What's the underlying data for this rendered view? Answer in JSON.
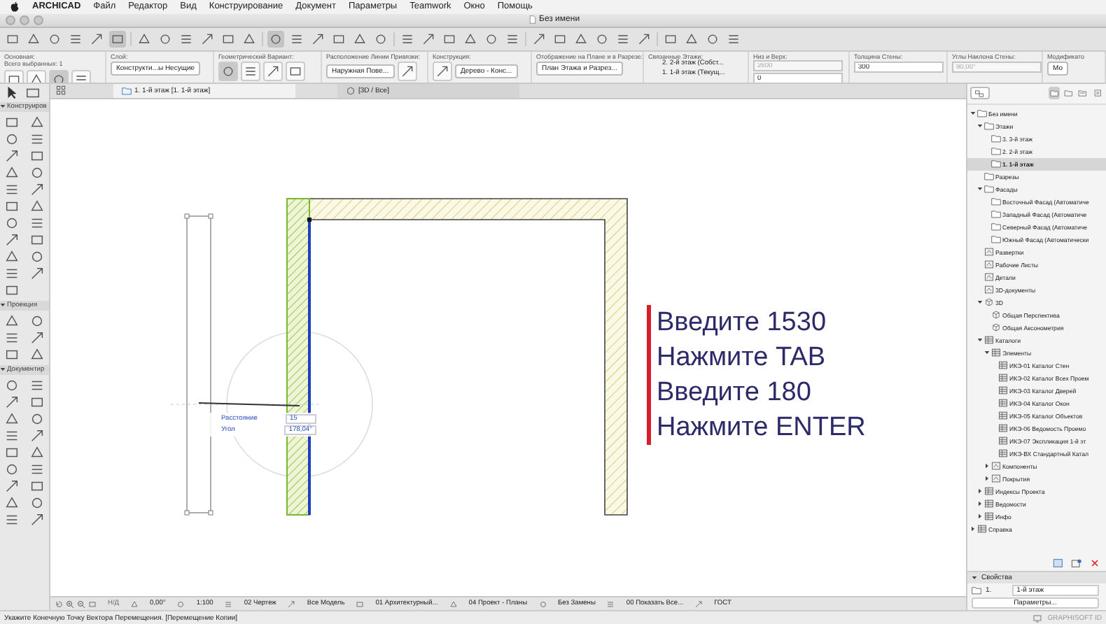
{
  "menubar": {
    "app": "ARCHICAD",
    "items": [
      "Файл",
      "Редактор",
      "Вид",
      "Конструирование",
      "Документ",
      "Параметры",
      "Teamwork",
      "Окно",
      "Помощь"
    ]
  },
  "window": {
    "title": "Без имени"
  },
  "info_box": {
    "groups": [
      {
        "label": "Основная:",
        "sublabel": "Всего выбранных: 1",
        "controls": [
          {
            "kind": "icon_button",
            "selected": false
          },
          {
            "kind": "icon_button",
            "selected": false
          },
          {
            "kind": "icon_button",
            "selected": true
          },
          {
            "kind": "icon_button",
            "selected": false
          }
        ]
      },
      {
        "label": "Слой:",
        "controls": [
          {
            "kind": "dropdown",
            "text": "Конструкти...ы Несущие"
          }
        ]
      },
      {
        "label": "Геометрический Вариант:",
        "controls": [
          {
            "kind": "icon_button",
            "selected": true
          },
          {
            "kind": "icon_button",
            "selected": false
          },
          {
            "kind": "icon_button",
            "selected": false
          },
          {
            "kind": "icon_button",
            "selected": false
          }
        ]
      },
      {
        "label": "Расположение Линии Привязки:",
        "controls": [
          {
            "kind": "dropdown",
            "text": "Наружная Пове..."
          },
          {
            "kind": "icon_button",
            "selected": false
          }
        ]
      },
      {
        "label": "Конструкция:",
        "controls": [
          {
            "kind": "icon_button",
            "selected": false
          },
          {
            "kind": "dropdown",
            "text": "Дерево - Конс..."
          }
        ]
      },
      {
        "label": "Отображение на Плане и в Разрезе:",
        "controls": [
          {
            "kind": "dropdown",
            "text": "План Этажа и Разрез..."
          }
        ]
      },
      {
        "label": "Связанные Этажи:",
        "controls": [
          {
            "kind": "line",
            "text": "2. 2-й этаж (Собст..."
          },
          {
            "kind": "line",
            "text": "1. 1-й этаж (Текущ..."
          }
        ]
      },
      {
        "label": "Низ и Верх:",
        "controls": [
          {
            "kind": "field",
            "text": "2600",
            "disabled": true
          },
          {
            "kind": "field",
            "text": "0",
            "disabled": false
          }
        ]
      },
      {
        "label": "Толщина Стены:",
        "controls": [
          {
            "kind": "field",
            "text": "300",
            "disabled": false
          }
        ]
      },
      {
        "label": "Углы Наклона Стены:",
        "controls": [
          {
            "kind": "field",
            "text": "90,00°",
            "disabled": true
          }
        ]
      },
      {
        "label": "Модификато",
        "controls": [
          {
            "kind": "dropdown",
            "text": "Мо"
          }
        ]
      }
    ]
  },
  "tabs": [
    {
      "label": "1. 1-й этаж [1. 1-й этаж]",
      "selected": true
    },
    {
      "label": "[3D / Все]",
      "selected": false
    }
  ],
  "toolbox": {
    "sections": [
      {
        "label": "Конструиров",
        "expanded": true
      },
      {
        "label": "Проекция",
        "expanded": true
      },
      {
        "label": "Документир",
        "expanded": true
      }
    ]
  },
  "tracker": {
    "rows": [
      {
        "label": "Расстояние",
        "value": "15"
      },
      {
        "label": "Угол",
        "value": "178,04°"
      }
    ]
  },
  "instructions": [
    "Введите 1530",
    "Нажмите TAB",
    "Введите 180",
    "Нажмите ENTER"
  ],
  "navigator": {
    "tree": [
      {
        "label": "Без имени",
        "kind": "folder",
        "expanded": true,
        "selected": false,
        "children": [
          {
            "label": "Этажи",
            "kind": "folder",
            "expanded": true,
            "selected": false,
            "children": [
              {
                "label": "3. 3-й этаж",
                "kind": "folder",
                "selected": false
              },
              {
                "label": "2. 2-й этаж",
                "kind": "folder",
                "selected": false
              },
              {
                "label": "1. 1-й этаж",
                "kind": "folder",
                "selected": true
              }
            ]
          },
          {
            "label": "Разрезы",
            "kind": "folder",
            "selected": false
          },
          {
            "label": "Фасады",
            "kind": "folder",
            "expanded": true,
            "selected": false,
            "children": [
              {
                "label": "Восточный Фасад (Автоматиче",
                "kind": "folder",
                "selected": false
              },
              {
                "label": "Западный Фасад (Автоматиче",
                "kind": "folder",
                "selected": false
              },
              {
                "label": "Северный Фасад (Автоматиче",
                "kind": "folder",
                "selected": false
              },
              {
                "label": "Южный Фасад (Автоматически",
                "kind": "folder",
                "selected": false
              }
            ]
          },
          {
            "label": "Развертки",
            "kind": "sheet",
            "selected": false
          },
          {
            "label": "Рабочие Листы",
            "kind": "sheet",
            "selected": false
          },
          {
            "label": "Детали",
            "kind": "sheet",
            "selected": false
          },
          {
            "label": "3D-документы",
            "kind": "sheet",
            "selected": false
          },
          {
            "label": "3D",
            "kind": "cube",
            "expanded": true,
            "selected": false,
            "children": [
              {
                "label": "Общая Перспектива",
                "kind": "cube",
                "selected": false
              },
              {
                "label": "Общая Аксонометрия",
                "kind": "cube",
                "selected": false
              }
            ]
          },
          {
            "label": "Каталоги",
            "kind": "table",
            "expanded": true,
            "selected": false,
            "children": [
              {
                "label": "Элементы",
                "kind": "table",
                "expanded": true,
                "selected": false,
                "children": [
                  {
                    "label": "ИКЭ-01 Каталог Стен",
                    "kind": "table",
                    "selected": false
                  },
                  {
                    "label": "ИКЭ-02 Каталог Всех Проем",
                    "kind": "table",
                    "selected": false
                  },
                  {
                    "label": "ИКЭ-03 Каталог Дверей",
                    "kind": "table",
                    "selected": false
                  },
                  {
                    "label": "ИКЭ-04 Каталог Окон",
                    "kind": "table",
                    "selected": false
                  },
                  {
                    "label": "ИКЭ-05 Каталог Объектов",
                    "kind": "table",
                    "selected": false
                  },
                  {
                    "label": "ИКЭ-06 Ведомость Проемо",
                    "kind": "table",
                    "selected": false
                  },
                  {
                    "label": "ИКЭ-07 Экспликация 1-й эт",
                    "kind": "table",
                    "selected": false
                  },
                  {
                    "label": "ИКЭ-ВХ Стандартный Катал",
                    "kind": "table",
                    "selected": false
                  }
                ]
              },
              {
                "label": "Компоненты",
                "kind": "sheet",
                "expanded": false,
                "selected": false
              },
              {
                "label": "Покрытия",
                "kind": "sheet",
                "expanded": false,
                "selected": false
              }
            ]
          },
          {
            "label": "Индексы Проекта",
            "kind": "table",
            "expanded": false,
            "selected": false
          },
          {
            "label": "Ведомости",
            "kind": "table",
            "expanded": false,
            "selected": false
          },
          {
            "label": "Инфо",
            "kind": "table",
            "expanded": false,
            "selected": false
          }
        ]
      },
      {
        "label": "Справка",
        "kind": "table",
        "expanded": false,
        "selected": false
      }
    ],
    "properties": {
      "title": "Свойства",
      "expanded": true,
      "number": "1.",
      "name": "1-й этаж",
      "button": "Параметры..."
    }
  },
  "status_bar": {
    "items": [
      "Н/Д",
      "0,00°",
      "1:100",
      "02 Чертеж",
      "Все Модель",
      "01 Архитектурный...",
      "04 Проект - Планы",
      "Без Замены",
      "00 Показать Все...",
      "ГОСТ"
    ]
  },
  "message": "Укажите Конечную Точку Вектора Перемещения. [Перемещение Копии]",
  "account": "GRAPHISOFT ID"
}
